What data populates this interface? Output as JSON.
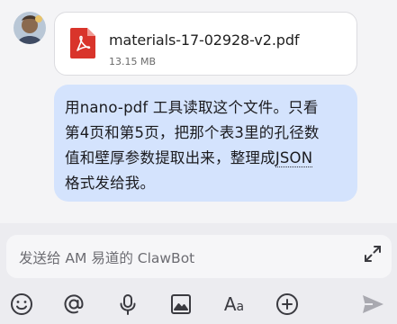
{
  "message": {
    "attachment": {
      "file_name": "materials-17-02928-v2.pdf",
      "file_size": "13.15 MB",
      "icon": "pdf-icon"
    },
    "text_line1": "用nano-pdf 工具读取这个文件。只看",
    "text_line2": "第4页和第5页，把那个表3里的孔径数",
    "text_line3_pre": "值和壁厚参数提取出来，整理成",
    "text_line3_link": "JSON",
    "text_line4": "格式发给我。"
  },
  "composer": {
    "placeholder": "发送给 AM 易道的 ClawBot",
    "tools": [
      "emoji-icon",
      "mention-icon",
      "microphone-icon",
      "image-icon",
      "text-format-icon",
      "add-icon",
      "send-icon"
    ],
    "format_label_big": "A",
    "format_label_small": "a"
  },
  "colors": {
    "bubble": "#d4e3fd",
    "pdf_red": "#d9342b",
    "composer_bg": "#ececf0"
  }
}
